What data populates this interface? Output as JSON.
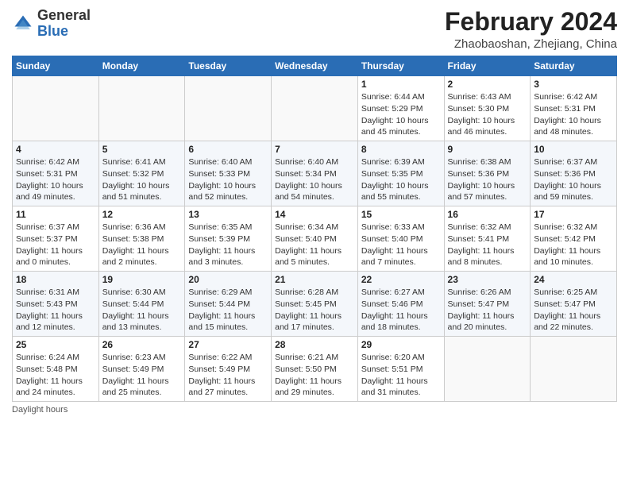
{
  "header": {
    "logo_general": "General",
    "logo_blue": "Blue",
    "month_year": "February 2024",
    "location": "Zhaobaoshan, Zhejiang, China"
  },
  "days_of_week": [
    "Sunday",
    "Monday",
    "Tuesday",
    "Wednesday",
    "Thursday",
    "Friday",
    "Saturday"
  ],
  "weeks": [
    [
      {
        "day": "",
        "info": ""
      },
      {
        "day": "",
        "info": ""
      },
      {
        "day": "",
        "info": ""
      },
      {
        "day": "",
        "info": ""
      },
      {
        "day": "1",
        "info": "Sunrise: 6:44 AM\nSunset: 5:29 PM\nDaylight: 10 hours\nand 45 minutes."
      },
      {
        "day": "2",
        "info": "Sunrise: 6:43 AM\nSunset: 5:30 PM\nDaylight: 10 hours\nand 46 minutes."
      },
      {
        "day": "3",
        "info": "Sunrise: 6:42 AM\nSunset: 5:31 PM\nDaylight: 10 hours\nand 48 minutes."
      }
    ],
    [
      {
        "day": "4",
        "info": "Sunrise: 6:42 AM\nSunset: 5:31 PM\nDaylight: 10 hours\nand 49 minutes."
      },
      {
        "day": "5",
        "info": "Sunrise: 6:41 AM\nSunset: 5:32 PM\nDaylight: 10 hours\nand 51 minutes."
      },
      {
        "day": "6",
        "info": "Sunrise: 6:40 AM\nSunset: 5:33 PM\nDaylight: 10 hours\nand 52 minutes."
      },
      {
        "day": "7",
        "info": "Sunrise: 6:40 AM\nSunset: 5:34 PM\nDaylight: 10 hours\nand 54 minutes."
      },
      {
        "day": "8",
        "info": "Sunrise: 6:39 AM\nSunset: 5:35 PM\nDaylight: 10 hours\nand 55 minutes."
      },
      {
        "day": "9",
        "info": "Sunrise: 6:38 AM\nSunset: 5:36 PM\nDaylight: 10 hours\nand 57 minutes."
      },
      {
        "day": "10",
        "info": "Sunrise: 6:37 AM\nSunset: 5:36 PM\nDaylight: 10 hours\nand 59 minutes."
      }
    ],
    [
      {
        "day": "11",
        "info": "Sunrise: 6:37 AM\nSunset: 5:37 PM\nDaylight: 11 hours\nand 0 minutes."
      },
      {
        "day": "12",
        "info": "Sunrise: 6:36 AM\nSunset: 5:38 PM\nDaylight: 11 hours\nand 2 minutes."
      },
      {
        "day": "13",
        "info": "Sunrise: 6:35 AM\nSunset: 5:39 PM\nDaylight: 11 hours\nand 3 minutes."
      },
      {
        "day": "14",
        "info": "Sunrise: 6:34 AM\nSunset: 5:40 PM\nDaylight: 11 hours\nand 5 minutes."
      },
      {
        "day": "15",
        "info": "Sunrise: 6:33 AM\nSunset: 5:40 PM\nDaylight: 11 hours\nand 7 minutes."
      },
      {
        "day": "16",
        "info": "Sunrise: 6:32 AM\nSunset: 5:41 PM\nDaylight: 11 hours\nand 8 minutes."
      },
      {
        "day": "17",
        "info": "Sunrise: 6:32 AM\nSunset: 5:42 PM\nDaylight: 11 hours\nand 10 minutes."
      }
    ],
    [
      {
        "day": "18",
        "info": "Sunrise: 6:31 AM\nSunset: 5:43 PM\nDaylight: 11 hours\nand 12 minutes."
      },
      {
        "day": "19",
        "info": "Sunrise: 6:30 AM\nSunset: 5:44 PM\nDaylight: 11 hours\nand 13 minutes."
      },
      {
        "day": "20",
        "info": "Sunrise: 6:29 AM\nSunset: 5:44 PM\nDaylight: 11 hours\nand 15 minutes."
      },
      {
        "day": "21",
        "info": "Sunrise: 6:28 AM\nSunset: 5:45 PM\nDaylight: 11 hours\nand 17 minutes."
      },
      {
        "day": "22",
        "info": "Sunrise: 6:27 AM\nSunset: 5:46 PM\nDaylight: 11 hours\nand 18 minutes."
      },
      {
        "day": "23",
        "info": "Sunrise: 6:26 AM\nSunset: 5:47 PM\nDaylight: 11 hours\nand 20 minutes."
      },
      {
        "day": "24",
        "info": "Sunrise: 6:25 AM\nSunset: 5:47 PM\nDaylight: 11 hours\nand 22 minutes."
      }
    ],
    [
      {
        "day": "25",
        "info": "Sunrise: 6:24 AM\nSunset: 5:48 PM\nDaylight: 11 hours\nand 24 minutes."
      },
      {
        "day": "26",
        "info": "Sunrise: 6:23 AM\nSunset: 5:49 PM\nDaylight: 11 hours\nand 25 minutes."
      },
      {
        "day": "27",
        "info": "Sunrise: 6:22 AM\nSunset: 5:49 PM\nDaylight: 11 hours\nand 27 minutes."
      },
      {
        "day": "28",
        "info": "Sunrise: 6:21 AM\nSunset: 5:50 PM\nDaylight: 11 hours\nand 29 minutes."
      },
      {
        "day": "29",
        "info": "Sunrise: 6:20 AM\nSunset: 5:51 PM\nDaylight: 11 hours\nand 31 minutes."
      },
      {
        "day": "",
        "info": ""
      },
      {
        "day": "",
        "info": ""
      }
    ]
  ],
  "footer": {
    "daylight_label": "Daylight hours"
  }
}
